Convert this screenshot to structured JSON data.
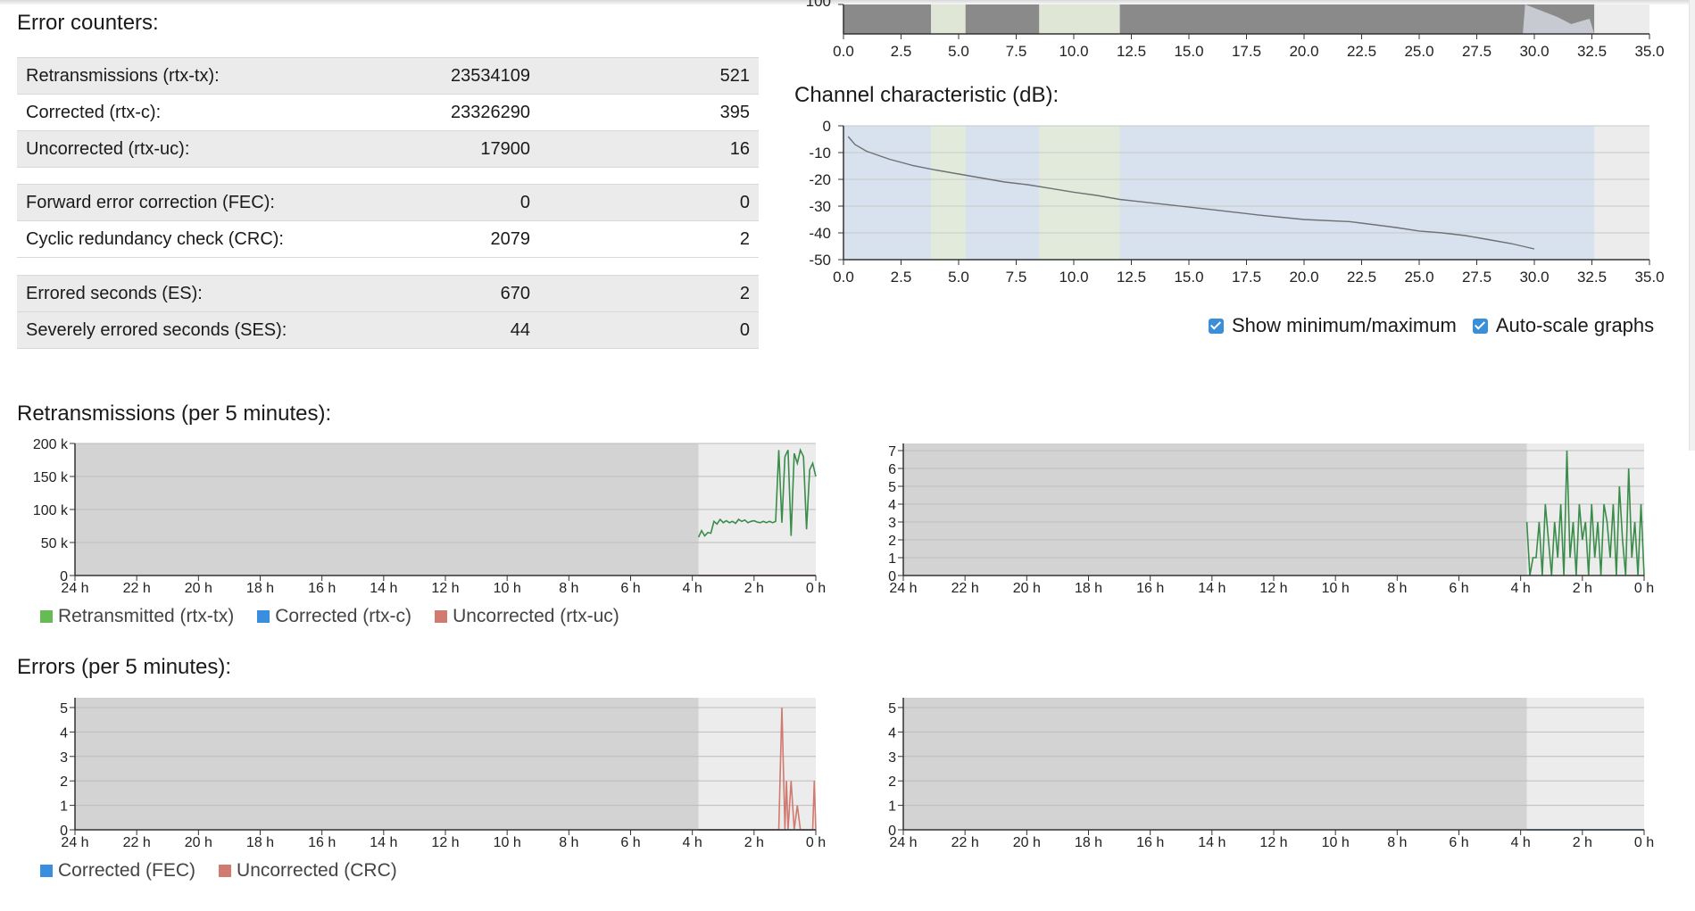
{
  "colors": {
    "green": "#3a8c4a",
    "legend_green": "#66bb55",
    "blue": "#3a8ee0",
    "red": "#d07a70",
    "bg_old": "#d3d3d3",
    "bg_recent": "#ececec",
    "band_blue": "#d8e1ee",
    "band_green": "#e2eadb"
  },
  "error_counters": {
    "title": "Error counters:",
    "groups": [
      [
        {
          "label": "Retransmissions (rtx-tx):",
          "v1": "23534109",
          "v2": "521"
        },
        {
          "label": "Corrected (rtx-c):",
          "v1": "23326290",
          "v2": "395"
        },
        {
          "label": "Uncorrected (rtx-uc):",
          "v1": "17900",
          "v2": "16"
        }
      ],
      [
        {
          "label": "Forward error correction (FEC):",
          "v1": "0",
          "v2": "0"
        },
        {
          "label": "Cyclic redundancy check (CRC):",
          "v1": "2079",
          "v2": "2"
        }
      ],
      [
        {
          "label": "Errored seconds (ES):",
          "v1": "670",
          "v2": "2"
        },
        {
          "label": "Severely errored seconds (SES):",
          "v1": "44",
          "v2": "0"
        }
      ]
    ]
  },
  "channel": {
    "title": "Channel characteristic (dB):",
    "options": {
      "show_minmax": "Show minimum/maximum",
      "autoscale": "Auto-scale graphs"
    }
  },
  "retransmissions": {
    "title": "Retransmissions (per 5 minutes):",
    "legend": [
      "Retransmitted (rtx-tx)",
      "Corrected (rtx-c)",
      "Uncorrected (rtx-uc)"
    ]
  },
  "errors": {
    "title": "Errors (per 5 minutes):",
    "legend": [
      "Corrected (FEC)",
      "Uncorrected (CRC)"
    ]
  },
  "chart_data": [
    {
      "id": "spectrum_top",
      "type": "area",
      "x_ticks": [
        "0.0",
        "2.5",
        "5.0",
        "7.5",
        "10.0",
        "12.5",
        "15.0",
        "17.5",
        "20.0",
        "22.5",
        "25.0",
        "27.5",
        "30.0",
        "32.5",
        "35.0"
      ],
      "xlim": [
        0,
        35
      ],
      "bands": [
        {
          "from": 0.0,
          "to": 3.8,
          "kind": "upstream"
        },
        {
          "from": 3.8,
          "to": 5.3,
          "kind": "downstream"
        },
        {
          "from": 5.3,
          "to": 8.5,
          "kind": "upstream"
        },
        {
          "from": 8.5,
          "to": 12.0,
          "kind": "downstream"
        },
        {
          "from": 12.0,
          "to": 32.6,
          "kind": "upstream"
        }
      ]
    },
    {
      "id": "channel_characteristic",
      "type": "line",
      "x_ticks": [
        "0.0",
        "2.5",
        "5.0",
        "7.5",
        "10.0",
        "12.5",
        "15.0",
        "17.5",
        "20.0",
        "22.5",
        "25.0",
        "27.5",
        "30.0",
        "32.5",
        "35.0"
      ],
      "y_ticks": [
        "0",
        "-10",
        "-20",
        "-30",
        "-40",
        "-50"
      ],
      "xlim": [
        0,
        35
      ],
      "ylim": [
        -50,
        0
      ],
      "x": [
        0.2,
        0.5,
        1,
        2,
        3,
        4,
        5,
        6,
        7,
        8,
        9,
        10,
        11,
        12,
        14,
        16,
        18,
        20,
        22,
        24,
        25,
        26,
        27,
        28,
        29,
        30.0
      ],
      "y": [
        -4,
        -7,
        -9.5,
        -12.5,
        -14.8,
        -16.5,
        -18,
        -19.5,
        -21,
        -22,
        -23.4,
        -24.8,
        -26,
        -27.5,
        -29.4,
        -31.3,
        -33.3,
        -35,
        -35.8,
        -38,
        -39.3,
        -40,
        -41,
        -42.5,
        -44,
        -46
      ],
      "bands": [
        {
          "from": 0.0,
          "to": 3.8,
          "kind": "upstream"
        },
        {
          "from": 3.8,
          "to": 5.3,
          "kind": "downstream"
        },
        {
          "from": 5.3,
          "to": 8.5,
          "kind": "upstream"
        },
        {
          "from": 8.5,
          "to": 12.0,
          "kind": "downstream"
        },
        {
          "from": 12.0,
          "to": 32.6,
          "kind": "upstream"
        }
      ]
    },
    {
      "id": "retrans_left",
      "type": "line",
      "x_ticks": [
        "24 h",
        "22 h",
        "20 h",
        "18 h",
        "16 h",
        "14 h",
        "12 h",
        "10 h",
        "8 h",
        "6 h",
        "4 h",
        "2 h",
        "0 h"
      ],
      "y_ticks": [
        "0",
        "50 k",
        "100 k",
        "150 k",
        "200 k"
      ],
      "xlim": [
        24,
        0
      ],
      "ylim": [
        0,
        200000
      ],
      "recent_from": 3.8,
      "series": [
        {
          "name": "Retransmitted (rtx-tx)",
          "color": "green",
          "x": [
            3.8,
            3.7,
            3.6,
            3.5,
            3.4,
            3.3,
            3.2,
            3.1,
            3.0,
            2.9,
            2.8,
            2.7,
            2.6,
            2.5,
            2.4,
            2.3,
            2.2,
            2.1,
            2.0,
            1.9,
            1.8,
            1.7,
            1.6,
            1.5,
            1.4,
            1.3,
            1.2,
            1.1,
            1.0,
            0.9,
            0.8,
            0.7,
            0.6,
            0.5,
            0.4,
            0.3,
            0.2,
            0.1,
            0.0
          ],
          "y": [
            58000,
            68000,
            60000,
            65000,
            64000,
            82000,
            78000,
            85000,
            80000,
            83000,
            80000,
            82000,
            79000,
            85000,
            82000,
            84000,
            80000,
            82000,
            83000,
            81000,
            80000,
            82000,
            80000,
            82000,
            80000,
            82000,
            190000,
            80000,
            180000,
            190000,
            60000,
            185000,
            170000,
            190000,
            180000,
            70000,
            160000,
            170000,
            150000
          ]
        },
        {
          "name": "Uncorrected (rtx-uc)",
          "color": "red",
          "x": [
            3.8,
            0.0
          ],
          "y": [
            0,
            0
          ]
        }
      ]
    },
    {
      "id": "retrans_right",
      "type": "line",
      "x_ticks": [
        "24 h",
        "22 h",
        "20 h",
        "18 h",
        "16 h",
        "14 h",
        "12 h",
        "10 h",
        "8 h",
        "6 h",
        "4 h",
        "2 h",
        "0 h"
      ],
      "y_ticks": [
        "0",
        "1",
        "2",
        "3",
        "4",
        "5",
        "6",
        "7"
      ],
      "xlim": [
        24,
        0
      ],
      "ylim": [
        0,
        7.4
      ],
      "recent_from": 3.8,
      "series": [
        {
          "name": "Retransmitted (rtx-tx)",
          "color": "green",
          "x": [
            3.8,
            3.7,
            3.6,
            3.5,
            3.4,
            3.3,
            3.2,
            3.1,
            3.0,
            2.9,
            2.8,
            2.7,
            2.6,
            2.5,
            2.4,
            2.3,
            2.2,
            2.1,
            2.0,
            1.9,
            1.8,
            1.7,
            1.6,
            1.5,
            1.4,
            1.3,
            1.2,
            1.1,
            1.0,
            0.9,
            0.8,
            0.7,
            0.6,
            0.5,
            0.4,
            0.3,
            0.2,
            0.1,
            0.0
          ],
          "y": [
            3,
            0,
            1,
            1,
            3,
            0,
            4,
            2,
            0,
            3,
            1,
            4,
            0,
            7,
            1,
            3,
            0,
            4,
            2,
            3,
            0,
            4,
            1,
            3,
            0,
            4,
            3,
            1,
            4,
            0,
            5,
            2,
            0,
            6,
            1,
            3,
            0,
            4,
            0
          ]
        }
      ]
    },
    {
      "id": "errors_left",
      "type": "line",
      "x_ticks": [
        "24 h",
        "22 h",
        "20 h",
        "18 h",
        "16 h",
        "14 h",
        "12 h",
        "10 h",
        "8 h",
        "6 h",
        "4 h",
        "2 h",
        "0 h"
      ],
      "y_ticks": [
        "0",
        "1",
        "2",
        "3",
        "4",
        "5"
      ],
      "xlim": [
        24,
        0
      ],
      "ylim": [
        0,
        5.4
      ],
      "recent_from": 3.8,
      "series": [
        {
          "name": "Corrected (FEC)",
          "color": "blue",
          "x": [
            3.8,
            0.0
          ],
          "y": [
            0,
            0
          ]
        },
        {
          "name": "Uncorrected (CRC)",
          "color": "red",
          "x": [
            3.8,
            1.3,
            1.2,
            1.1,
            1.0,
            0.95,
            0.9,
            0.8,
            0.7,
            0.6,
            0.5,
            0.4,
            0.3,
            0.2,
            0.1,
            0.05,
            0.0
          ],
          "y": [
            0,
            0,
            0,
            5,
            0,
            2,
            0,
            2,
            0,
            1,
            0,
            0,
            0,
            0,
            0,
            2,
            0
          ]
        }
      ]
    },
    {
      "id": "errors_right",
      "type": "line",
      "x_ticks": [
        "24 h",
        "22 h",
        "20 h",
        "18 h",
        "16 h",
        "14 h",
        "12 h",
        "10 h",
        "8 h",
        "6 h",
        "4 h",
        "2 h",
        "0 h"
      ],
      "y_ticks": [
        "0",
        "1",
        "2",
        "3",
        "4",
        "5"
      ],
      "xlim": [
        24,
        0
      ],
      "ylim": [
        0,
        5.4
      ],
      "recent_from": 3.8,
      "series": [
        {
          "name": "Corrected (FEC)",
          "color": "blue",
          "x": [
            3.8,
            0.0
          ],
          "y": [
            0,
            0
          ]
        }
      ]
    }
  ]
}
